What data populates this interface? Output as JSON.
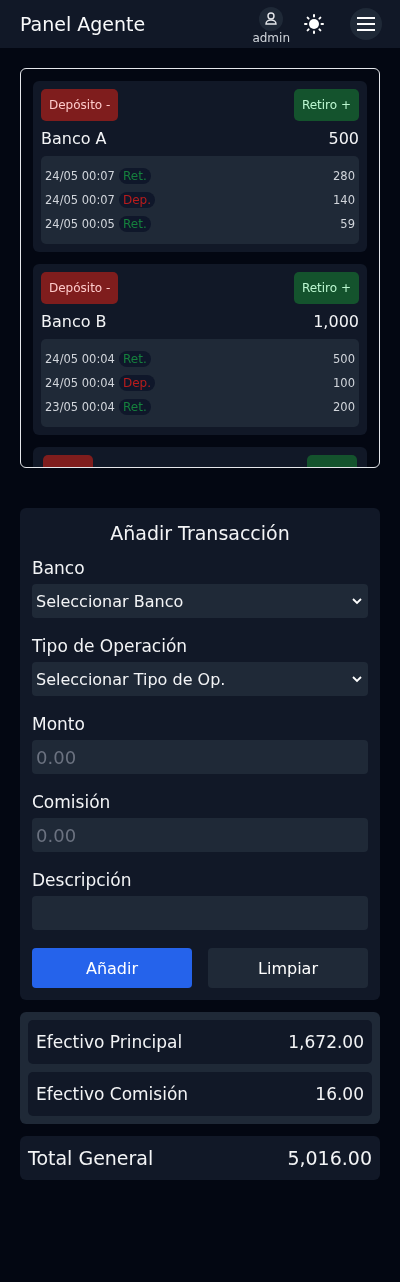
{
  "header": {
    "title": "Panel Agente",
    "user": "admin"
  },
  "banks": [
    {
      "deposit_button": "Depósito -",
      "withdraw_button": "Retiro +",
      "name": "Banco A",
      "balance": "500",
      "transactions": [
        {
          "time": "24/05 00:07",
          "kind": "ret",
          "tag": "Ret.",
          "amount": "280"
        },
        {
          "time": "24/05 00:07",
          "kind": "dep",
          "tag": "Dep.",
          "amount": "140"
        },
        {
          "time": "24/05 00:05",
          "kind": "ret",
          "tag": "Ret.",
          "amount": "59"
        }
      ]
    },
    {
      "deposit_button": "Depósito -",
      "withdraw_button": "Retiro +",
      "name": "Banco B",
      "balance": "1,000",
      "transactions": [
        {
          "time": "24/05 00:04",
          "kind": "ret",
          "tag": "Ret.",
          "amount": "500"
        },
        {
          "time": "24/05 00:04",
          "kind": "dep",
          "tag": "Dep.",
          "amount": "100"
        },
        {
          "time": "23/05 00:04",
          "kind": "ret",
          "tag": "Ret.",
          "amount": "200"
        }
      ]
    }
  ],
  "form": {
    "title": "Añadir Transacción",
    "fields": [
      {
        "label": "Banco",
        "kind": "select",
        "value": "Seleccionar Banco"
      },
      {
        "label": "Tipo de Operación",
        "kind": "select",
        "value": "Seleccionar Tipo de Op."
      },
      {
        "label": "Monto",
        "kind": "input",
        "placeholder": "0.00"
      },
      {
        "label": "Comisión",
        "kind": "input",
        "placeholder": "0.00"
      },
      {
        "label": "Descripción",
        "kind": "input"
      }
    ],
    "submit_button": "Añadir",
    "clear_button": "Limpiar"
  },
  "cash": [
    {
      "label": "Efectivo Principal",
      "value": "1,672.00"
    },
    {
      "label": "Efectivo Comisión",
      "value": "16.00"
    }
  ],
  "total": {
    "label": "Total General",
    "value": "5,016.00"
  }
}
